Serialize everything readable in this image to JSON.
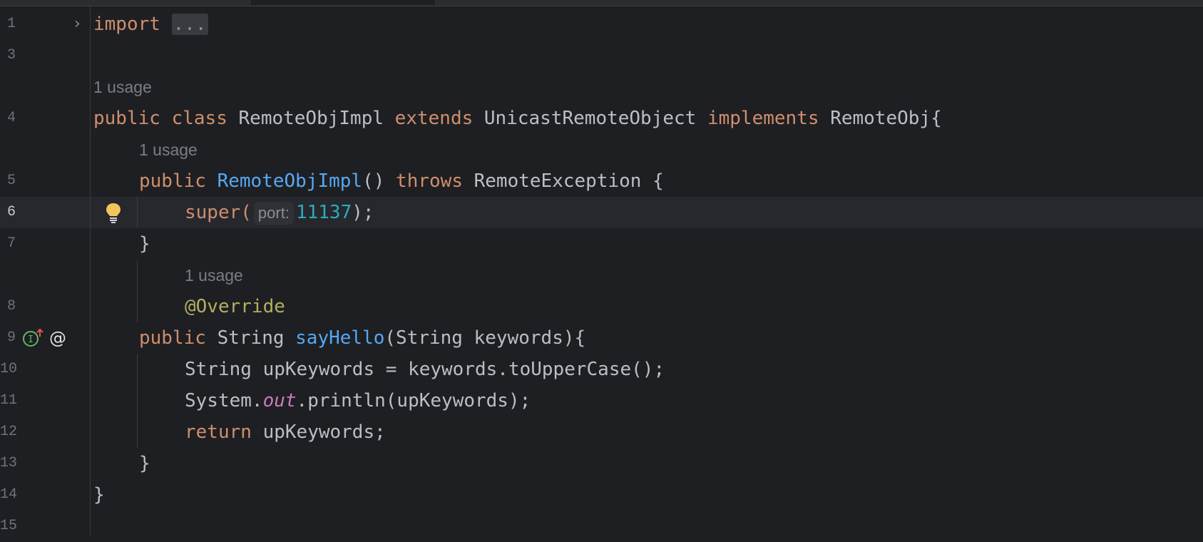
{
  "editor": {
    "lines": [
      {
        "num": "1",
        "import_kw": "import",
        "fold": "..."
      },
      {
        "num": "3"
      },
      {
        "hint": "1 usage"
      },
      {
        "num": "4",
        "t1": "public",
        "t2": "class",
        "t3": "RemoteObjImpl",
        "t4": "extends",
        "t5": "UnicastRemoteObject",
        "t6": "implements",
        "t7": "RemoteObj{"
      },
      {
        "hint": "1 usage"
      },
      {
        "num": "5",
        "t1": "public",
        "t2": "RemoteObjImpl",
        "t3": "()",
        "t4": "throws",
        "t5": "RemoteException {"
      },
      {
        "num": "6",
        "t1": "super(",
        "param_hint": "port:",
        "t2": "11137",
        "t3": ");"
      },
      {
        "num": "7",
        "t1": "}"
      },
      {
        "hint": "1 usage"
      },
      {
        "num": "8",
        "t1": "@Override"
      },
      {
        "num": "9",
        "t1": "public",
        "t2": "String",
        "t3": "sayHello",
        "t4": "(String keywords){"
      },
      {
        "num": "10",
        "t1": "String upKeywords = keywords.toUpperCase();"
      },
      {
        "num": "11",
        "t1": "System.",
        "t2": "out",
        "t3": ".println(upKeywords);"
      },
      {
        "num": "12",
        "t1": "return",
        "t2": " upKeywords;"
      },
      {
        "num": "13",
        "t1": "}"
      },
      {
        "num": "14",
        "t1": "}"
      },
      {
        "num": "15"
      }
    ]
  },
  "icons": {
    "fold": "chevron-right-icon",
    "intention": "lightbulb-icon",
    "implements": "implemented-method-icon",
    "override": "override-annotation-icon"
  },
  "colors": {
    "background": "#1e1f22",
    "keyword": "#cf8e6d",
    "function": "#56a8f5",
    "number": "#2aacb8",
    "annotation": "#b3ae60",
    "static_field": "#c77dbb",
    "text": "#bcbec4",
    "hint": "#7a7e85"
  }
}
